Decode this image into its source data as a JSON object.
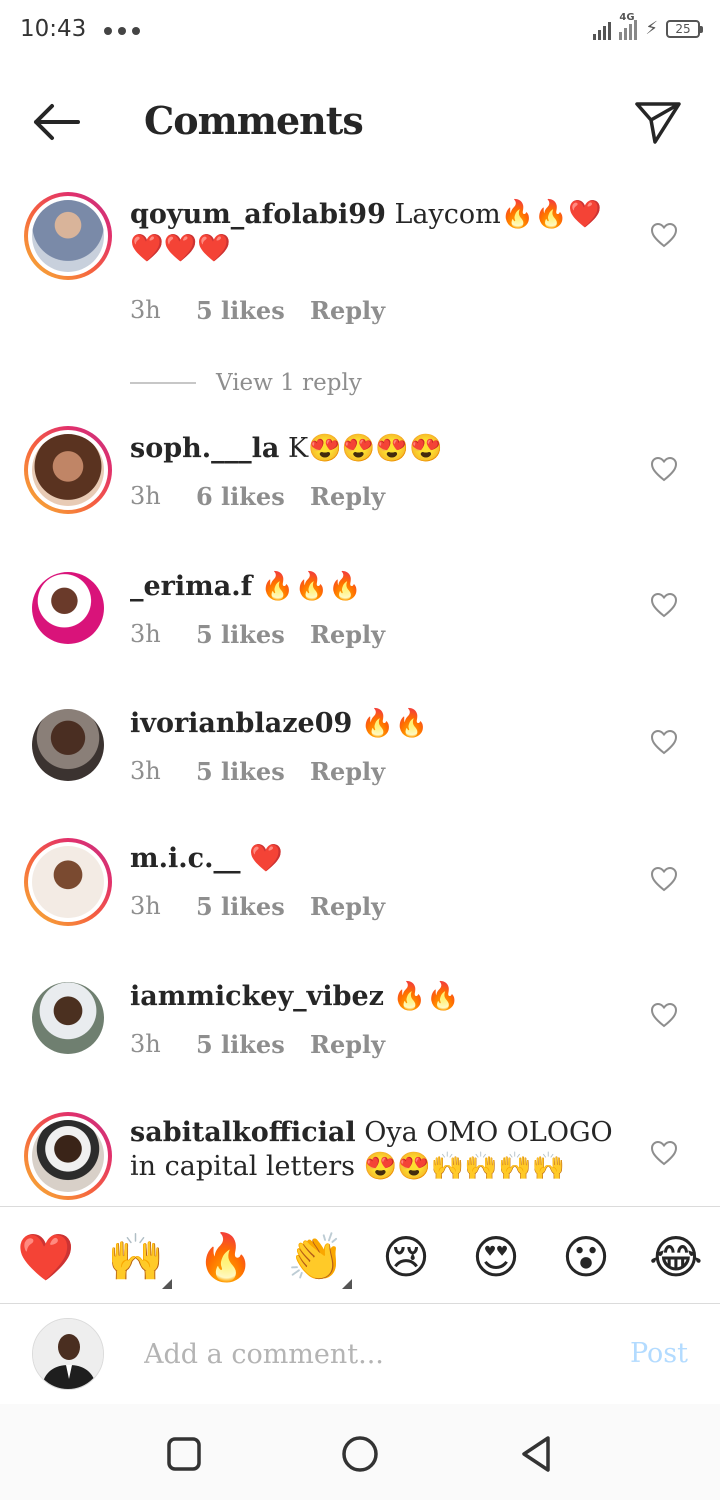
{
  "status_bar": {
    "time": "10:43",
    "network": "4G",
    "battery": "25"
  },
  "header": {
    "title": "Comments",
    "back_icon": "arrow-left-icon",
    "share_icon": "paper-plane-icon"
  },
  "comments": [
    {
      "username": "qoyum_afolabi99",
      "text": " Laycom🔥🔥❤️❤️❤️❤️",
      "time": "3h",
      "likes": "5 likes",
      "reply": "Reply",
      "view_replies": "View 1 reply",
      "has_story_ring": true
    },
    {
      "username": "soph.___la",
      "text": " K😍😍😍😍",
      "time": "3h",
      "likes": "6 likes",
      "reply": "Reply",
      "has_story_ring": true
    },
    {
      "username": "_erima.f",
      "text": " 🔥🔥🔥",
      "time": "3h",
      "likes": "5 likes",
      "reply": "Reply",
      "has_story_ring": false
    },
    {
      "username": "ivorianblaze09",
      "text": " 🔥🔥",
      "time": "3h",
      "likes": "5 likes",
      "reply": "Reply",
      "has_story_ring": false
    },
    {
      "username": "m.i.c.__",
      "text": " ❤️",
      "time": "3h",
      "likes": "5 likes",
      "reply": "Reply",
      "has_story_ring": true
    },
    {
      "username": "iammickey_vibez",
      "text": " 🔥🔥",
      "time": "3h",
      "likes": "5 likes",
      "reply": "Reply",
      "has_story_ring": false
    },
    {
      "username": "sabitalkofficial",
      "text": " Oya OMO OLOGO in capital letters 😍😍🙌🙌🙌🙌",
      "has_story_ring": true
    }
  ],
  "emoji_bar": [
    "❤️",
    "🙌",
    "🔥",
    "👏",
    "😢",
    "😍",
    "😮",
    "😂"
  ],
  "composer": {
    "placeholder": "Add a comment...",
    "post_label": "Post"
  },
  "colors": {
    "text": "#262626",
    "muted": "#8e8e8e",
    "post_disabled": "#b3dbff",
    "divider": "#dbdbdb"
  }
}
